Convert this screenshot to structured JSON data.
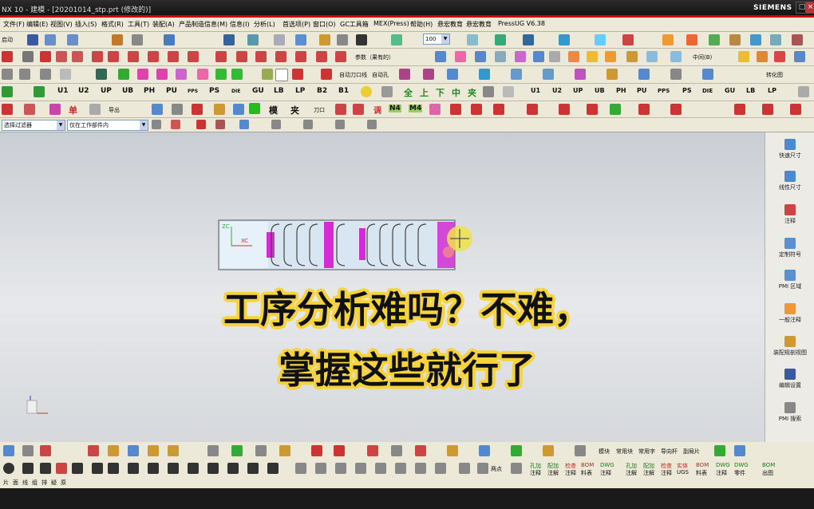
{
  "titlebar": {
    "title": "NX 10 - 建模 - [20201014_stp.prt (修改的)]",
    "brand": "SIEMENS",
    "max": "□",
    "close": "×"
  },
  "menu": [
    {
      "label": "文件(F)"
    },
    {
      "label": "编辑(E)"
    },
    {
      "label": "视图(V)"
    },
    {
      "label": "插入(S)"
    },
    {
      "label": "格式(R)"
    },
    {
      "label": "工具(T)"
    },
    {
      "label": "装配(A)"
    },
    {
      "label": "产品制造信息(M)"
    },
    {
      "label": "信息(I)"
    },
    {
      "label": "分析(L)"
    },
    {
      "label": "首选项(P)"
    },
    {
      "label": "窗口(O)"
    },
    {
      "label": "GC工具箱"
    },
    {
      "label": "MEX(Press)"
    },
    {
      "label": "帮助(H)"
    },
    {
      "label": "悬宏教育"
    },
    {
      "label": "悬宏教育"
    },
    {
      "label": "PressUG V6.38"
    }
  ],
  "toolbar1": {
    "start": "启动",
    "zoom": "100"
  },
  "toolbar2": {
    "param": "参数（果有的）",
    "filter_label": "中间(B)"
  },
  "toolbar3": {
    "auto_cut": "自动刀口线",
    "auto_hole": "自动孔",
    "convert": "转化图"
  },
  "toolbar4": {
    "labels": [
      "U1",
      "U2",
      "UP",
      "UB",
      "PH",
      "PU",
      "PPS",
      "PS",
      "DIE",
      "GU",
      "LB",
      "LP",
      "B2",
      "B1"
    ],
    "right_labels": [
      "U1",
      "U2",
      "UP",
      "UB",
      "PH",
      "PU",
      "PPS",
      "PS",
      "DIE",
      "GU",
      "LB",
      "LP"
    ],
    "cn": [
      "全",
      "上",
      "下",
      "中",
      "夹"
    ]
  },
  "toolbar5": {
    "single": "单",
    "export": "导出",
    "model": "模",
    "clamp": "夹",
    "knife": "刀口",
    "tune": "调",
    "n4": "N4",
    "m4": "M4"
  },
  "filter": {
    "type_filter": "选择过滤器",
    "scope": "仅在工作部件内"
  },
  "viewport": {
    "axis_zc": "ZC",
    "axis_xc": "XC"
  },
  "caption": {
    "line1": "工序分析难吗？不难，",
    "line2": "掌握这些就行了"
  },
  "rightpanel": [
    {
      "label": "快速尺寸"
    },
    {
      "label": "线性尺寸"
    },
    {
      "label": "注释"
    },
    {
      "label": "定制符号"
    },
    {
      "label": "PMI 区域"
    },
    {
      "label": "一般注释"
    },
    {
      "label": "装配规剖视图"
    },
    {
      "label": "编辑设置"
    },
    {
      "label": "PMI 搜索"
    }
  ],
  "bottom1": {
    "items": [
      "模块",
      "常用块",
      "常用字",
      "导向杆",
      "副局片"
    ]
  },
  "bottom2": {
    "notes": [
      "孔加",
      "配加",
      "检查",
      "BOM",
      "DWG",
      "孔加",
      "配加",
      "检查",
      "实体",
      "BOM",
      "DWG",
      "DWG",
      "BOM"
    ],
    "subs": [
      "注释",
      "注解",
      "注释",
      "料表",
      "注释",
      "注解",
      "注解",
      "注释",
      "UGS",
      "料表",
      "注释",
      "零件",
      "出图"
    ],
    "measure": "两点"
  },
  "bottom3": {
    "items": [
      "片",
      "面",
      "线",
      "组",
      "排",
      "疑",
      "原"
    ]
  }
}
